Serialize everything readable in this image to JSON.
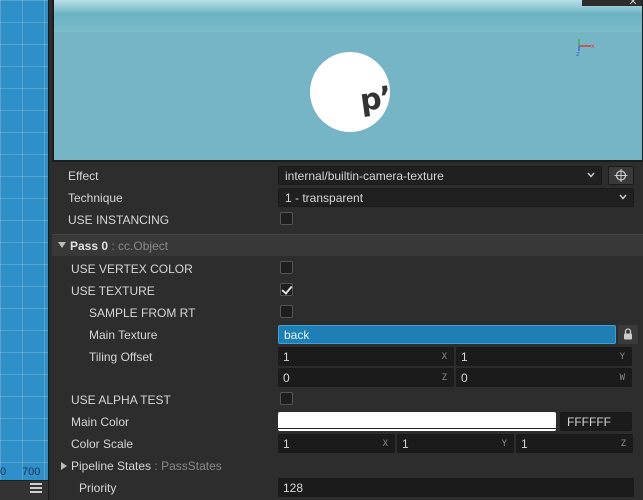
{
  "scene": {
    "axis_labels": [
      "0",
      "700"
    ]
  },
  "preview": {
    "sphere_text": "pʼ"
  },
  "properties": {
    "effect": {
      "label": "Effect",
      "value": "internal/builtin-camera-texture"
    },
    "technique": {
      "label": "Technique",
      "value": "1 - transparent"
    },
    "use_instancing": {
      "label": "USE INSTANCING",
      "checked": false
    }
  },
  "pass": {
    "title": "Pass 0",
    "type": ": cc.Object",
    "use_vertex_color": {
      "label": "USE VERTEX COLOR",
      "checked": false
    },
    "use_texture": {
      "label": "USE TEXTURE",
      "checked": true
    },
    "sample_from_rt": {
      "label": "SAMPLE FROM RT",
      "checked": false
    },
    "main_texture": {
      "label": "Main Texture",
      "value": "back"
    },
    "tiling_offset": {
      "label": "Tiling Offset",
      "x": "1",
      "y": "1",
      "z": "0",
      "w": "0",
      "axes": [
        "X",
        "Y",
        "Z",
        "W"
      ]
    },
    "use_alpha_test": {
      "label": "USE ALPHA TEST",
      "checked": false
    },
    "main_color": {
      "label": "Main Color",
      "hex": "FFFFFF",
      "swatch": "#ffffff"
    },
    "color_scale": {
      "label": "Color Scale",
      "x": "1",
      "y": "1",
      "z": "1",
      "axes": [
        "X",
        "Y",
        "Z"
      ]
    },
    "pipeline_states": {
      "label": "Pipeline States",
      "type": ": PassStates"
    },
    "priority": {
      "label": "Priority",
      "value": "128"
    }
  },
  "colors": {
    "accent": "#1d7fb3",
    "panel_bg": "#2d2d2d",
    "scene_bg": "#2f8fc9",
    "preview_bg": "#76b5c6"
  },
  "icons": [
    "close-icon",
    "axis-gizmo-icon",
    "chevron-down-icon",
    "target-icon",
    "lock-icon",
    "menu-icon"
  ]
}
